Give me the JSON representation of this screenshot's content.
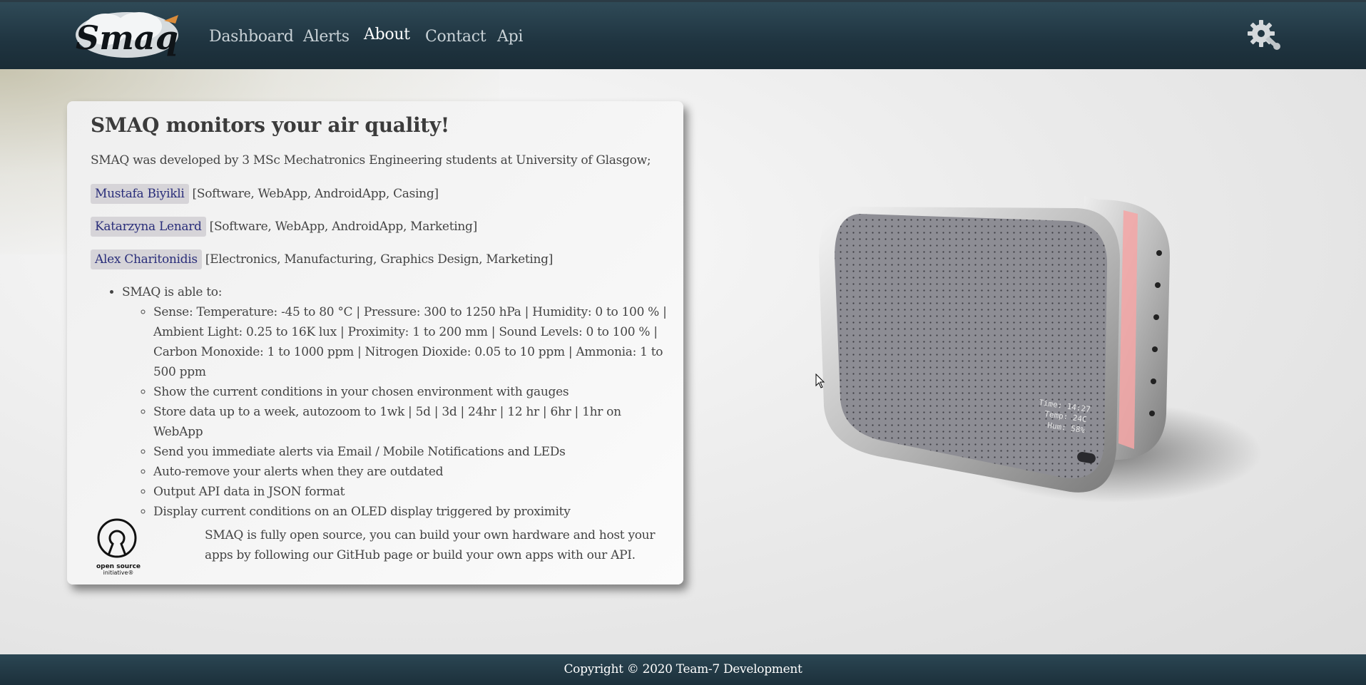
{
  "header": {
    "logo_text": "Smaq",
    "nav": [
      {
        "label": "Dashboard",
        "active": false
      },
      {
        "label": "Alerts",
        "active": false
      },
      {
        "label": "About",
        "active": true
      },
      {
        "label": "Contact",
        "active": false
      },
      {
        "label": "Api",
        "active": false
      }
    ],
    "settings_icon": "gear-wrench-icon"
  },
  "about": {
    "title": "SMAQ monitors your air quality!",
    "intro": "SMAQ was developed by 3 MSc Mechatronics Engineering students at University of Glasgow;",
    "members": [
      {
        "name": "Mustafa Biyikli",
        "roles": "[Software, WebApp, AndroidApp, Casing]"
      },
      {
        "name": "Katarzyna Lenard",
        "roles": "[Software, WebApp, AndroidApp, Marketing]"
      },
      {
        "name": "Alex Charitonidis",
        "roles": "[Electronics, Manufacturing, Graphics Design, Marketing]"
      }
    ],
    "capabilities_heading": "SMAQ is able to:",
    "capabilities": [
      "Sense: Temperature: -45 to 80 °C | Pressure: 300 to 1250 hPa | Humidity: 0 to 100 % | Ambient Light: 0.25 to 16K lux | Proximity: 1 to 200 mm | Sound Levels: 0 to 100 % | Carbon Monoxide: 1 to 1000 ppm | Nitrogen Dioxide: 0.05 to 10 ppm | Ammonia: 1 to 500 ppm",
      "Show the current conditions in your chosen environment with gauges",
      "Store data up to a week, autozoom to 1wk | 5d | 3d | 24hr | 12 hr | 6hr | 1hr on WebApp",
      "Send you immediate alerts via Email / Mobile Notifications and LEDs",
      "Auto-remove your alerts when they are outdated",
      "Output API data in JSON format",
      "Display current conditions on an OLED display triggered by proximity"
    ],
    "osi_logo_text": [
      "open source",
      "initiative®"
    ],
    "open_source_text": "SMAQ is fully open source, you can build your own hardware and host your apps by following our GitHub page or build your own apps with our API."
  },
  "device_display": {
    "time": "Time: 14:27",
    "temp": "Temp: 24C",
    "hum": "Hum: 58%"
  },
  "footer": {
    "copyright": "Copyright © 2020 Team-7 Development"
  },
  "colors": {
    "navbar": "#1f3440",
    "member_badge_bg": "#d6d4d8",
    "member_badge_text": "#2a2e7a",
    "device_led": "#f4a6a6"
  }
}
